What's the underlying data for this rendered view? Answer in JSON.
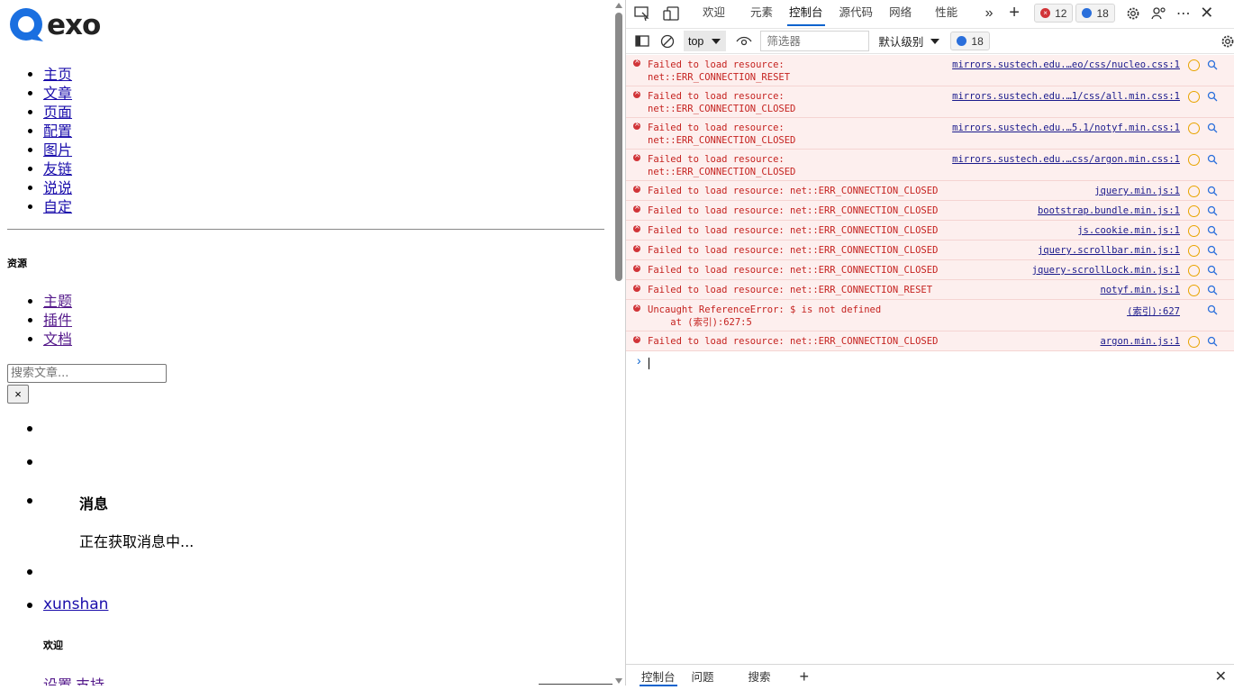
{
  "site": {
    "logo_text": "exo",
    "nav": [
      "主页",
      "文章",
      "页面",
      "配置",
      "图片",
      "友链",
      "说说",
      "自定"
    ],
    "resources_heading": "资源",
    "resources": [
      "主题",
      "插件",
      "文档"
    ],
    "search_placeholder": "搜索文章...",
    "close_label": "×",
    "messages_title": "消息",
    "messages_loading": "正在获取消息中...",
    "user_link": "xunshan",
    "welcome": "欢迎",
    "footer_links": [
      "设置",
      "支持"
    ]
  },
  "devtools": {
    "tabs": [
      "欢迎",
      "元素",
      "控制台",
      "源代码",
      "网络",
      "性能"
    ],
    "active_tab": "控制台",
    "error_count": "12",
    "message_count": "18",
    "context": "top",
    "filter_placeholder": "筛选器",
    "level_label": "默认级别",
    "issues_count": "18",
    "messages": [
      {
        "line1": "Failed to load resource:",
        "line2": "net::ERR_CONNECTION_RESET",
        "source": "mirrors.sustech.edu.…eo/css/nucleo.css:1"
      },
      {
        "line1": "Failed to load resource:",
        "line2": "net::ERR_CONNECTION_CLOSED",
        "source": "mirrors.sustech.edu.…1/css/all.min.css:1"
      },
      {
        "line1": "Failed to load resource:",
        "line2": "net::ERR_CONNECTION_CLOSED",
        "source": "mirrors.sustech.edu.…5.1/notyf.min.css:1"
      },
      {
        "line1": "Failed to load resource:",
        "line2": "net::ERR_CONNECTION_CLOSED",
        "source": "mirrors.sustech.edu.…css/argon.min.css:1"
      },
      {
        "line1": "Failed to load resource: net::ERR_CONNECTION_CLOSED",
        "line2": "",
        "source": "jquery.min.js:1"
      },
      {
        "line1": "Failed to load resource: net::ERR_CONNECTION_CLOSED",
        "line2": "",
        "source": "bootstrap.bundle.min.js:1"
      },
      {
        "line1": "Failed to load resource: net::ERR_CONNECTION_CLOSED",
        "line2": "",
        "source": "js.cookie.min.js:1"
      },
      {
        "line1": "Failed to load resource: net::ERR_CONNECTION_CLOSED",
        "line2": "",
        "source": "jquery.scrollbar.min.js:1"
      },
      {
        "line1": "Failed to load resource: net::ERR_CONNECTION_CLOSED",
        "line2": "",
        "source": "jquery-scrollLock.min.js:1"
      },
      {
        "line1": "Failed to load resource: net::ERR_CONNECTION_RESET",
        "line2": "",
        "source": "notyf.min.js:1"
      },
      {
        "line1": "Uncaught ReferenceError: $ is not defined",
        "line2": "    at (索引):627:5",
        "source": "(索引):627"
      },
      {
        "line1": "Failed to load resource: net::ERR_CONNECTION_CLOSED",
        "line2": "",
        "source": "argon.min.js:1"
      }
    ],
    "drawer_tabs": [
      "控制台",
      "问题",
      "搜索"
    ],
    "drawer_active": "控制台"
  }
}
